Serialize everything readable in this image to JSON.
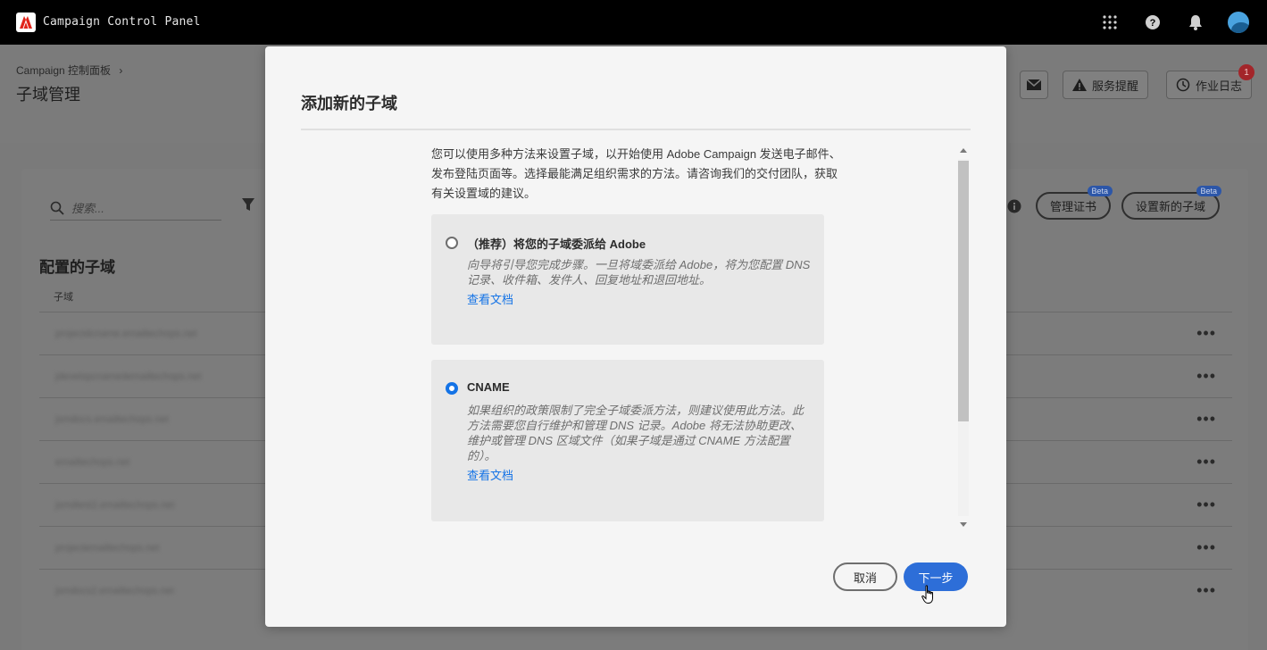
{
  "app": {
    "title": "Campaign Control Panel"
  },
  "topbar": {
    "icons": [
      "apps-grid-icon",
      "help-icon",
      "bell-icon",
      "avatar"
    ]
  },
  "page": {
    "breadcrumb": "Campaign 控制面板",
    "breadcrumb_sep": "›",
    "title": "子域管理",
    "header_buttons": {
      "mail_icon": "mail-icon",
      "alerts_label": "服务提醒",
      "joblog_label": "作业日志",
      "joblog_badge": "1"
    },
    "search_placeholder": "搜索...",
    "manage_cert_label": "管理证书",
    "setup_subdomain_label": "设置新的子域",
    "beta_label": "Beta",
    "section_title": "配置的子域",
    "column_header": "子域",
    "rows": [
      {
        "name": "projectdcname.emailtechops.net",
        "more": "•••"
      },
      {
        "name": "jdevelopcnamedemailtechops.net",
        "more": "•••"
      },
      {
        "name": "jsmdocs.emailtechops.net",
        "more": "•••"
      },
      {
        "name": "emailtechops.net",
        "more": "•••"
      },
      {
        "name": "jsmdtest2.emailtechops.net",
        "more": "•••"
      },
      {
        "name": "projectemailtechops.net",
        "more": "•••"
      },
      {
        "name": "jsmdocs2.emailtechops.net",
        "more": "•••"
      }
    ]
  },
  "modal": {
    "title": "添加新的子域",
    "intro": "您可以使用多种方法来设置子域，以开始使用 Adobe Campaign 发送电子邮件、发布登陆页面等。选择最能满足组织需求的方法。请咨询我们的交付团队，获取有关设置域的建议。",
    "options": [
      {
        "title": "（推荐）将您的子域委派给 Adobe",
        "description": "向导将引导您完成步骤。一旦将域委派给 Adobe，将为您配置 DNS 记录、收件箱、发件人、回复地址和退回地址。",
        "link": "查看文档",
        "selected": false
      },
      {
        "title": "CNAME",
        "description": "如果组织的政策限制了完全子域委派方法，则建议使用此方法。此方法需要您自行维护和管理 DNS 记录。Adobe 将无法协助更改、维护或管理 DNS 区域文件（如果子域是通过 CNAME 方法配置的）。",
        "link": "查看文档",
        "selected": true
      }
    ],
    "cancel_label": "取消",
    "next_label": "下一步"
  },
  "colors": {
    "accent": "#1473e6",
    "primary_button": "#2d6ed8",
    "topbar": "#000000",
    "badge": "#d7373f"
  }
}
